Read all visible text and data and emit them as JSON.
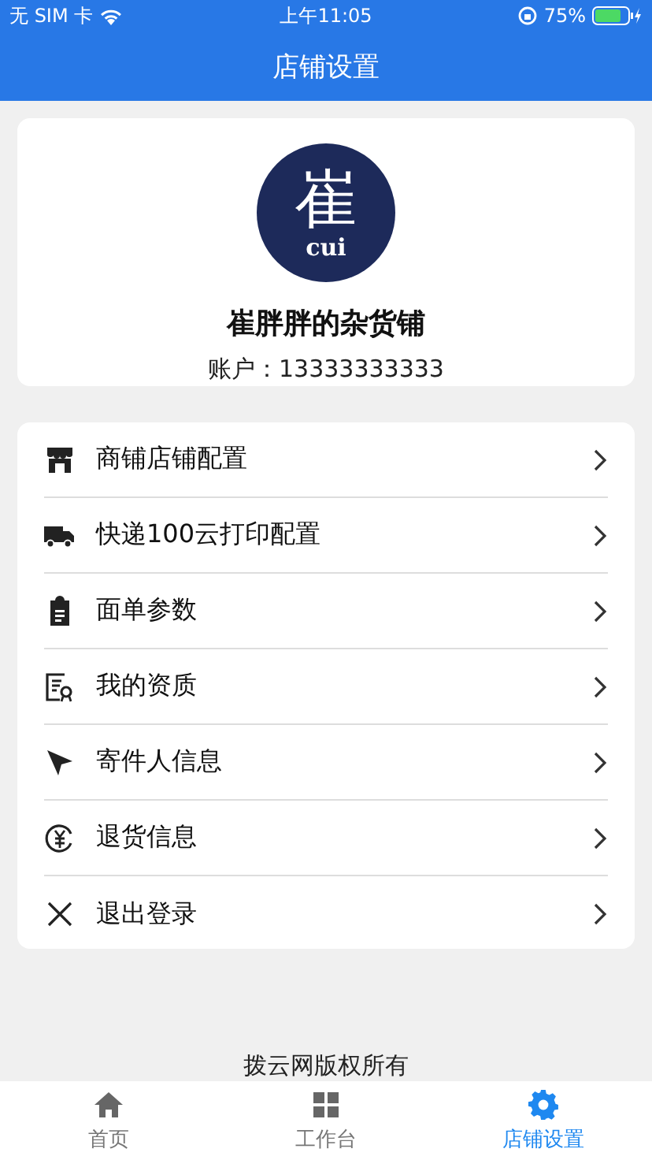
{
  "status_bar": {
    "carrier": "无 SIM 卡",
    "time": "上午11:05",
    "battery": "75%"
  },
  "header": {
    "title": "店铺设置"
  },
  "profile": {
    "logo_char": "崔",
    "logo_latin": "cui",
    "name": "崔胖胖的杂货铺",
    "account": "账户：13333333333"
  },
  "menu": [
    {
      "label": "商铺店铺配置"
    },
    {
      "label": "快递100云打印配置"
    },
    {
      "label": "面单参数"
    },
    {
      "label": "我的资质"
    },
    {
      "label": "寄件人信息"
    },
    {
      "label": "退货信息"
    },
    {
      "label": "退出登录"
    }
  ],
  "footer": "拨云网版权所有",
  "tabs": [
    {
      "label": "首页",
      "selected": false
    },
    {
      "label": "工作台",
      "selected": false
    },
    {
      "label": "店铺设置",
      "selected": true
    }
  ]
}
